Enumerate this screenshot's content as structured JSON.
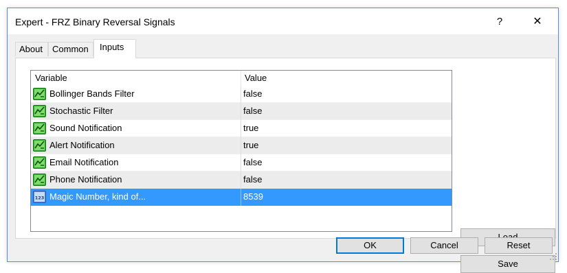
{
  "window": {
    "title": "Expert - FRZ Binary Reversal Signals",
    "help_label": "?",
    "close_label": "✕"
  },
  "tabs": [
    {
      "label": "About"
    },
    {
      "label": "Common"
    },
    {
      "label": "Inputs"
    }
  ],
  "table": {
    "headers": {
      "variable": "Variable",
      "value": "Value"
    },
    "rows": [
      {
        "variable": "Bollinger Bands Filter",
        "value": "false",
        "icon": "boolean-param-icon"
      },
      {
        "variable": "Stochastic Filter",
        "value": "false",
        "icon": "boolean-param-icon"
      },
      {
        "variable": "Sound Notification",
        "value": "true",
        "icon": "boolean-param-icon"
      },
      {
        "variable": "Alert Notification",
        "value": "true",
        "icon": "boolean-param-icon"
      },
      {
        "variable": "Email Notification",
        "value": "false",
        "icon": "boolean-param-icon"
      },
      {
        "variable": "Phone Notification",
        "value": "false",
        "icon": "boolean-param-icon"
      },
      {
        "variable": "Magic Number, kind of...",
        "value": "8539",
        "icon": "integer-param-icon",
        "selected": true
      }
    ]
  },
  "buttons": {
    "load": "Load",
    "save": "Save",
    "ok": "OK",
    "cancel": "Cancel",
    "reset": "Reset"
  },
  "colors": {
    "selection": "#3399ff",
    "window_border": "#5a8ad8",
    "default_button_border": "#0078d7"
  }
}
